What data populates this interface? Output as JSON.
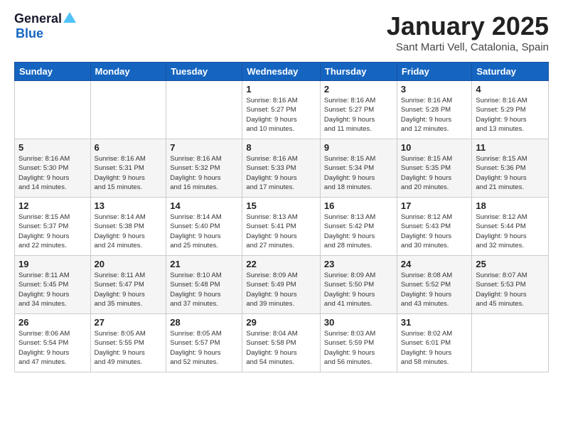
{
  "logo": {
    "general": "General",
    "blue": "Blue"
  },
  "title": "January 2025",
  "subtitle": "Sant Marti Vell, Catalonia, Spain",
  "headers": [
    "Sunday",
    "Monday",
    "Tuesday",
    "Wednesday",
    "Thursday",
    "Friday",
    "Saturday"
  ],
  "weeks": [
    [
      {
        "day": "",
        "info": ""
      },
      {
        "day": "",
        "info": ""
      },
      {
        "day": "",
        "info": ""
      },
      {
        "day": "1",
        "info": "Sunrise: 8:16 AM\nSunset: 5:27 PM\nDaylight: 9 hours\nand 10 minutes."
      },
      {
        "day": "2",
        "info": "Sunrise: 8:16 AM\nSunset: 5:27 PM\nDaylight: 9 hours\nand 11 minutes."
      },
      {
        "day": "3",
        "info": "Sunrise: 8:16 AM\nSunset: 5:28 PM\nDaylight: 9 hours\nand 12 minutes."
      },
      {
        "day": "4",
        "info": "Sunrise: 8:16 AM\nSunset: 5:29 PM\nDaylight: 9 hours\nand 13 minutes."
      }
    ],
    [
      {
        "day": "5",
        "info": "Sunrise: 8:16 AM\nSunset: 5:30 PM\nDaylight: 9 hours\nand 14 minutes."
      },
      {
        "day": "6",
        "info": "Sunrise: 8:16 AM\nSunset: 5:31 PM\nDaylight: 9 hours\nand 15 minutes."
      },
      {
        "day": "7",
        "info": "Sunrise: 8:16 AM\nSunset: 5:32 PM\nDaylight: 9 hours\nand 16 minutes."
      },
      {
        "day": "8",
        "info": "Sunrise: 8:16 AM\nSunset: 5:33 PM\nDaylight: 9 hours\nand 17 minutes."
      },
      {
        "day": "9",
        "info": "Sunrise: 8:15 AM\nSunset: 5:34 PM\nDaylight: 9 hours\nand 18 minutes."
      },
      {
        "day": "10",
        "info": "Sunrise: 8:15 AM\nSunset: 5:35 PM\nDaylight: 9 hours\nand 20 minutes."
      },
      {
        "day": "11",
        "info": "Sunrise: 8:15 AM\nSunset: 5:36 PM\nDaylight: 9 hours\nand 21 minutes."
      }
    ],
    [
      {
        "day": "12",
        "info": "Sunrise: 8:15 AM\nSunset: 5:37 PM\nDaylight: 9 hours\nand 22 minutes."
      },
      {
        "day": "13",
        "info": "Sunrise: 8:14 AM\nSunset: 5:38 PM\nDaylight: 9 hours\nand 24 minutes."
      },
      {
        "day": "14",
        "info": "Sunrise: 8:14 AM\nSunset: 5:40 PM\nDaylight: 9 hours\nand 25 minutes."
      },
      {
        "day": "15",
        "info": "Sunrise: 8:13 AM\nSunset: 5:41 PM\nDaylight: 9 hours\nand 27 minutes."
      },
      {
        "day": "16",
        "info": "Sunrise: 8:13 AM\nSunset: 5:42 PM\nDaylight: 9 hours\nand 28 minutes."
      },
      {
        "day": "17",
        "info": "Sunrise: 8:12 AM\nSunset: 5:43 PM\nDaylight: 9 hours\nand 30 minutes."
      },
      {
        "day": "18",
        "info": "Sunrise: 8:12 AM\nSunset: 5:44 PM\nDaylight: 9 hours\nand 32 minutes."
      }
    ],
    [
      {
        "day": "19",
        "info": "Sunrise: 8:11 AM\nSunset: 5:45 PM\nDaylight: 9 hours\nand 34 minutes."
      },
      {
        "day": "20",
        "info": "Sunrise: 8:11 AM\nSunset: 5:47 PM\nDaylight: 9 hours\nand 35 minutes."
      },
      {
        "day": "21",
        "info": "Sunrise: 8:10 AM\nSunset: 5:48 PM\nDaylight: 9 hours\nand 37 minutes."
      },
      {
        "day": "22",
        "info": "Sunrise: 8:09 AM\nSunset: 5:49 PM\nDaylight: 9 hours\nand 39 minutes."
      },
      {
        "day": "23",
        "info": "Sunrise: 8:09 AM\nSunset: 5:50 PM\nDaylight: 9 hours\nand 41 minutes."
      },
      {
        "day": "24",
        "info": "Sunrise: 8:08 AM\nSunset: 5:52 PM\nDaylight: 9 hours\nand 43 minutes."
      },
      {
        "day": "25",
        "info": "Sunrise: 8:07 AM\nSunset: 5:53 PM\nDaylight: 9 hours\nand 45 minutes."
      }
    ],
    [
      {
        "day": "26",
        "info": "Sunrise: 8:06 AM\nSunset: 5:54 PM\nDaylight: 9 hours\nand 47 minutes."
      },
      {
        "day": "27",
        "info": "Sunrise: 8:05 AM\nSunset: 5:55 PM\nDaylight: 9 hours\nand 49 minutes."
      },
      {
        "day": "28",
        "info": "Sunrise: 8:05 AM\nSunset: 5:57 PM\nDaylight: 9 hours\nand 52 minutes."
      },
      {
        "day": "29",
        "info": "Sunrise: 8:04 AM\nSunset: 5:58 PM\nDaylight: 9 hours\nand 54 minutes."
      },
      {
        "day": "30",
        "info": "Sunrise: 8:03 AM\nSunset: 5:59 PM\nDaylight: 9 hours\nand 56 minutes."
      },
      {
        "day": "31",
        "info": "Sunrise: 8:02 AM\nSunset: 6:01 PM\nDaylight: 9 hours\nand 58 minutes."
      },
      {
        "day": "",
        "info": ""
      }
    ]
  ]
}
